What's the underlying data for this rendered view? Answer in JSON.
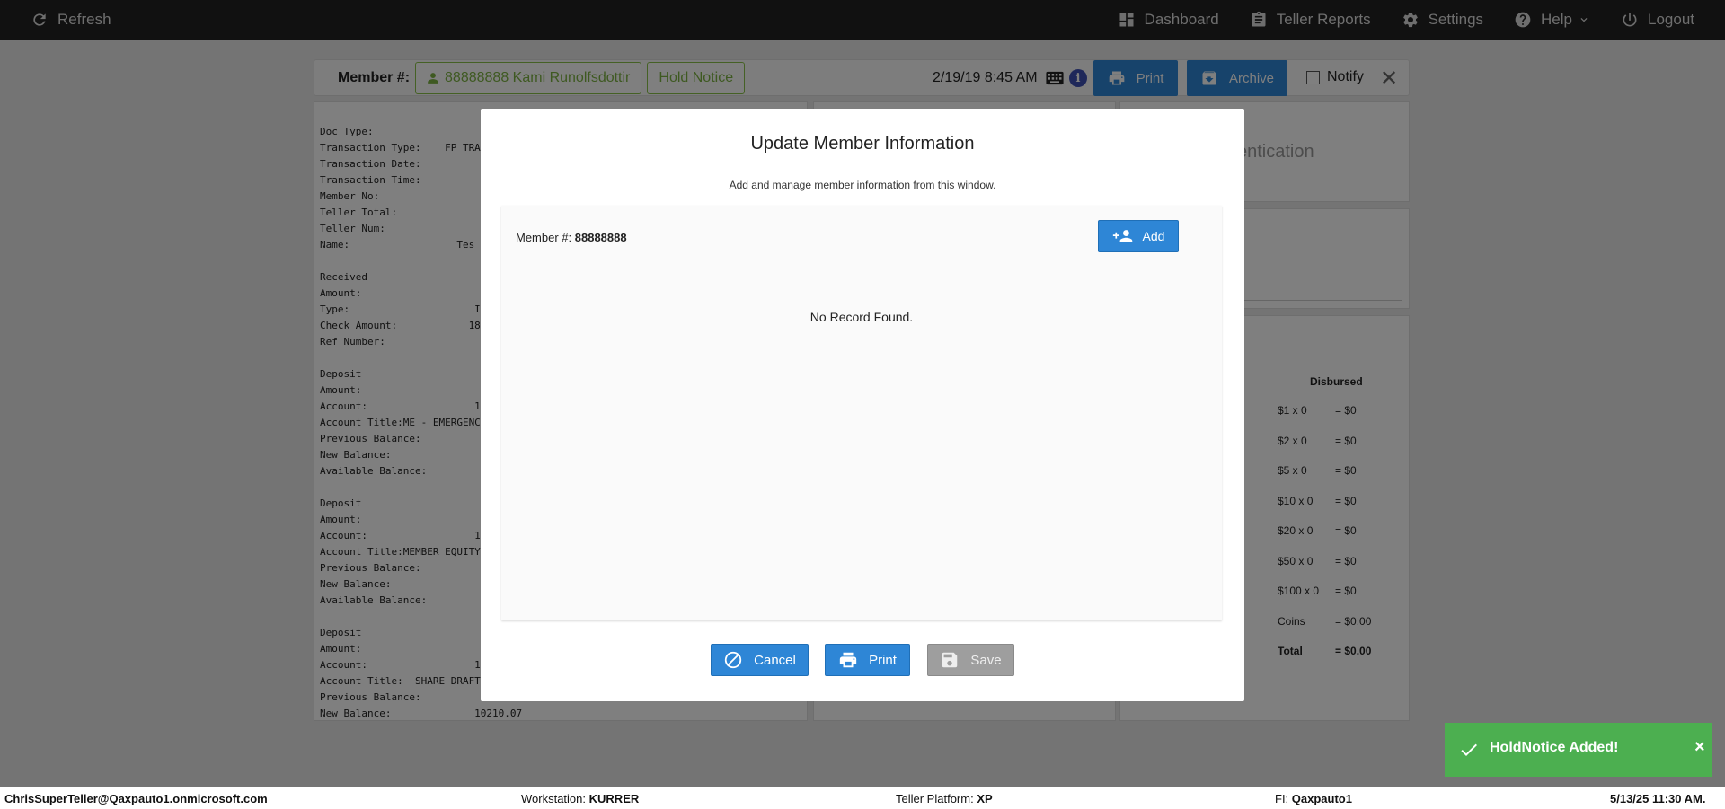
{
  "nav": {
    "refresh": "Refresh",
    "dashboard": "Dashboard",
    "teller_reports": "Teller Reports",
    "settings": "Settings",
    "help": "Help",
    "logout": "Logout"
  },
  "member_bar": {
    "label": "Member #:",
    "member": "88888888 Kami Runolfsdottir",
    "hold_notice": "Hold Notice",
    "datetime": "2/19/19 8:45 AM",
    "print": "Print",
    "archive": "Archive",
    "notify": "Notify"
  },
  "receipt_text": "Doc Type:\nTransaction Type:    FP TRA\nTransaction Date:\nTransaction Time:\nMember No:\nTeller Total:\nTeller Num:\nName:                  Tes\n\nReceived\nAmount:\nType:                     IN\nCheck Amount:            18\nRef Number:\n\nDeposit\nAmount:\nAccount:                  1\nAccount Title:ME - EMERGENC\nPrevious Balance:\nNew Balance:\nAvailable Balance:\n\nDeposit\nAmount:\nAccount:                  1\nAccount Title:MEMBER EQUITY\nPrevious Balance:\nNew Balance:\nAvailable Balance:\n\nDeposit\nAmount:\nAccount:                  1\nAccount Title:  SHARE DRAFT\nPrevious Balance:\nNew Balance:              10210.07",
  "auth_text": "entication",
  "disbursed": {
    "title": "Disbursed",
    "rows": [
      {
        "denom": "$1 x 0",
        "value": "= $0"
      },
      {
        "denom": "$2 x 0",
        "value": "= $0"
      },
      {
        "denom": "$5 x 0",
        "value": "= $0"
      },
      {
        "denom": "$10 x 0",
        "value": "= $0"
      },
      {
        "denom": "$20 x 0",
        "value": "= $0"
      },
      {
        "denom": "$50 x 0",
        "value": "= $0"
      },
      {
        "denom": "$100 x 0",
        "value": "= $0"
      },
      {
        "denom": "Coins",
        "value": "= $0.00"
      },
      {
        "denom": "Total",
        "value": "= $0.00"
      }
    ]
  },
  "modal": {
    "title": "Update Member Information",
    "subtitle": "Add and manage member information from this window.",
    "member_label": "Member #:",
    "member_number": "88888888",
    "add": "Add",
    "empty": "No Record Found.",
    "cancel": "Cancel",
    "print": "Print",
    "save": "Save"
  },
  "toast": {
    "message": "HoldNotice Added!",
    "close": "×"
  },
  "footer": {
    "user": "ChrisSuperTeller@Qaxpauto1.onmicrosoft.com",
    "workstation_label": "Workstation:",
    "workstation": "KURRER",
    "platform_label": "Teller Platform:",
    "platform": "XP",
    "fi_label": "FI:",
    "fi": "Qaxpauto1",
    "datetime": "5/13/25 11:30 AM."
  },
  "colors": {
    "primary": "#2e86d6",
    "success": "#4caf50",
    "member_green": "#7cb342",
    "navbar": "#222222"
  }
}
